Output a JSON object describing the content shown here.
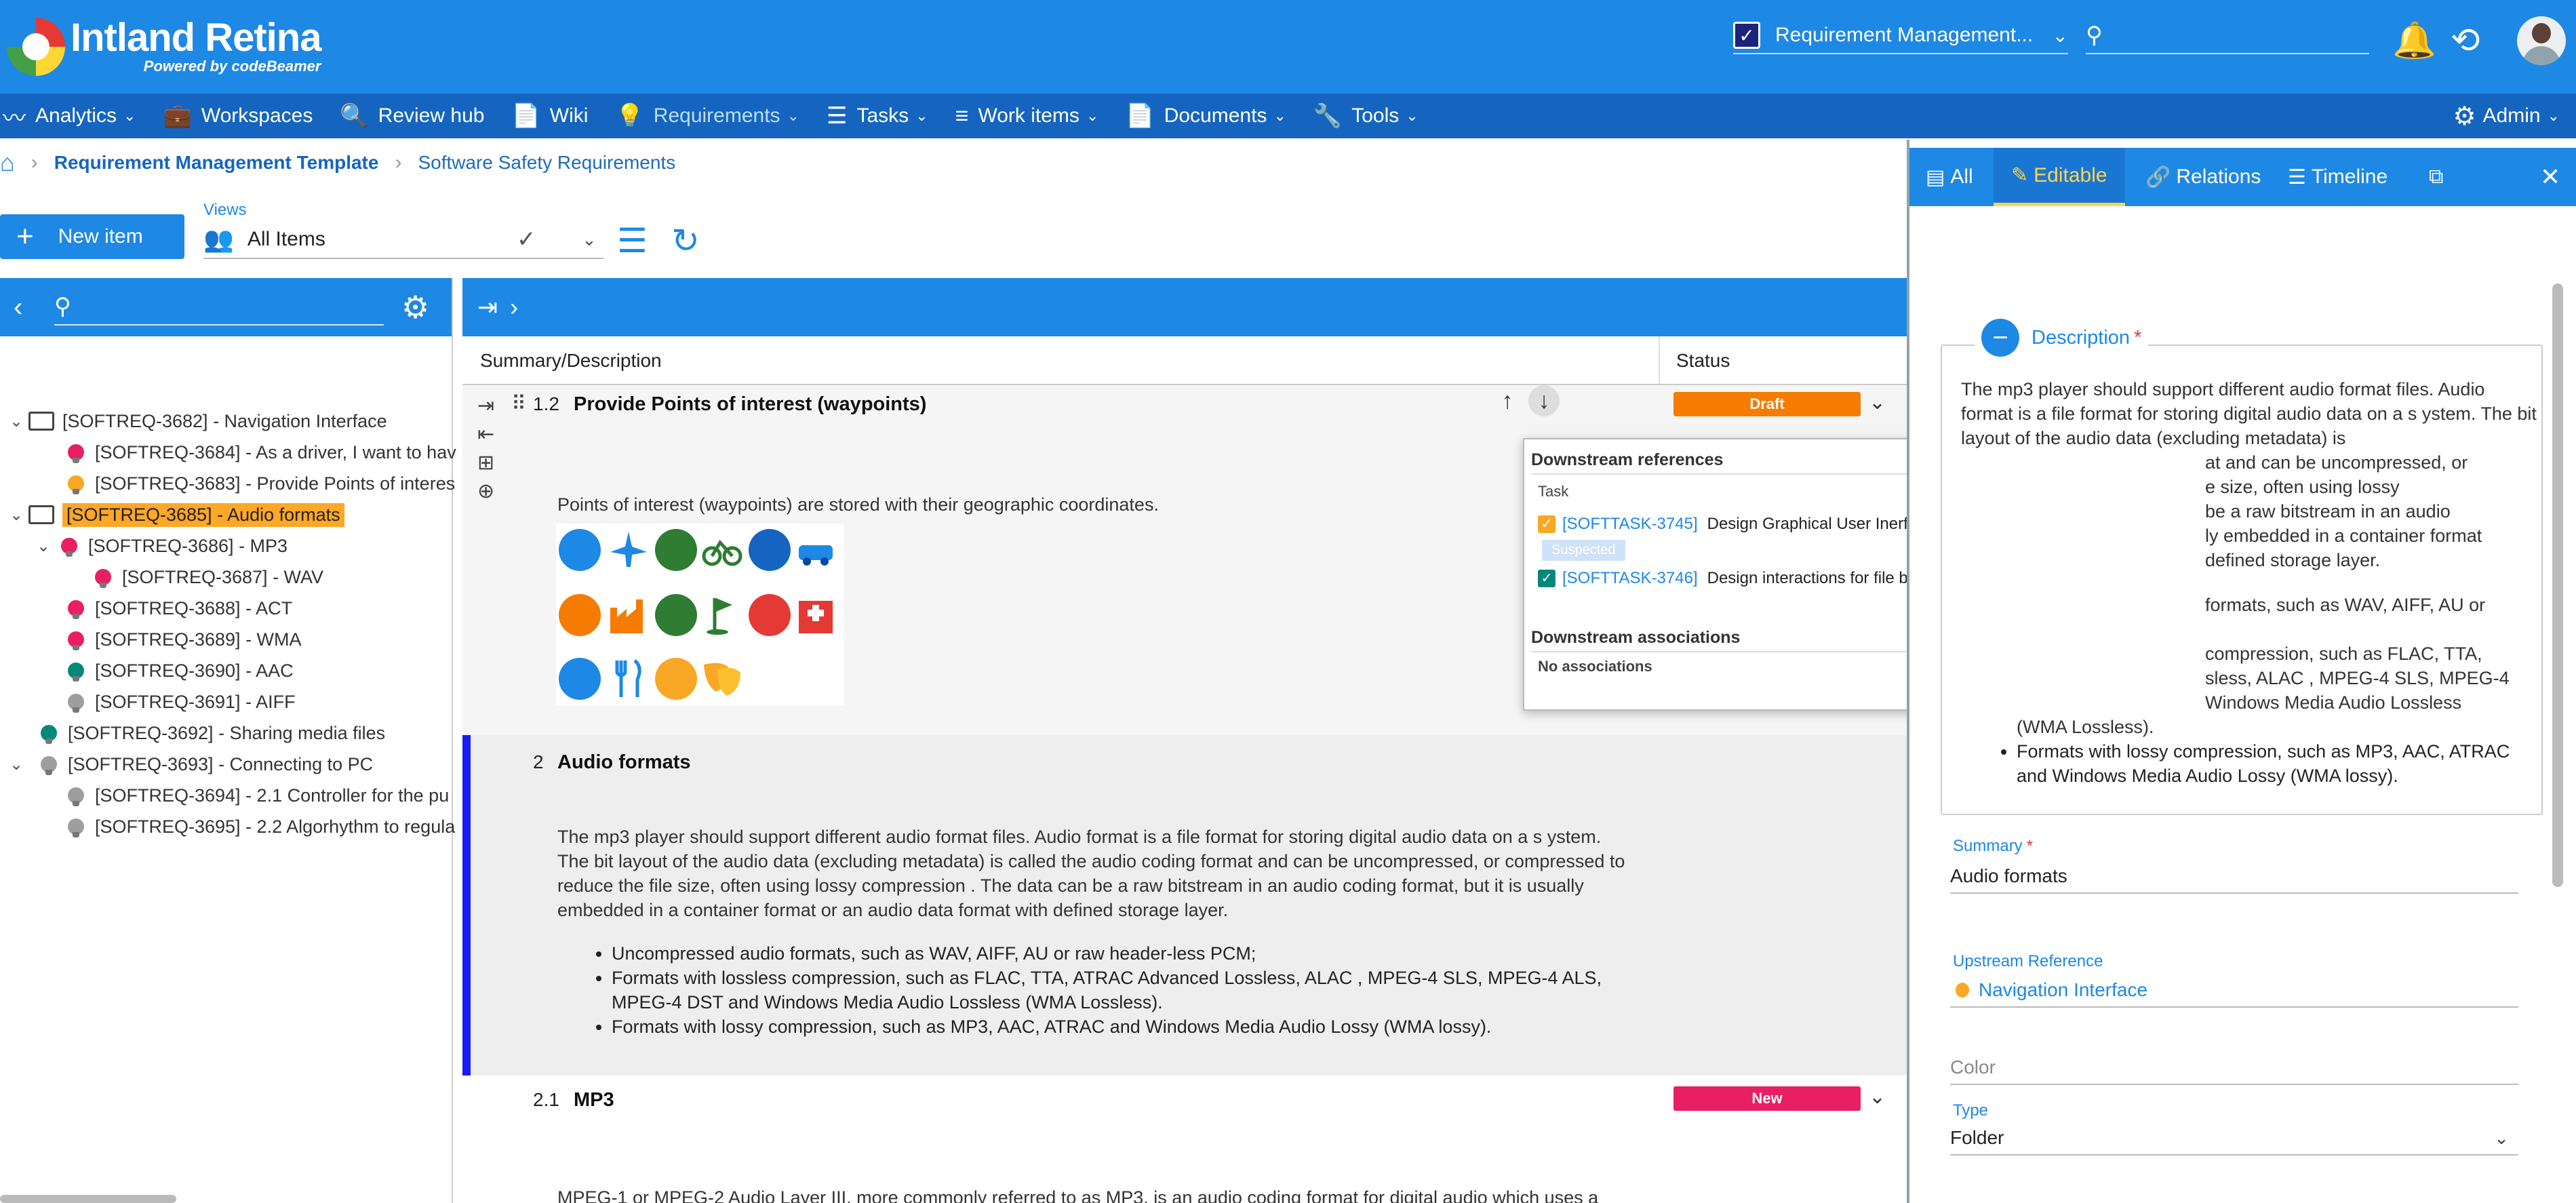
{
  "app": {
    "logo_title": "Intland Retina",
    "logo_sub": "Powered by codeBeamer",
    "project_select": "Requirement Management...",
    "search_placeholder": ""
  },
  "nav": {
    "items": [
      {
        "label": "Analytics",
        "icon": "chart-line-icon"
      },
      {
        "label": "Workspaces",
        "icon": "briefcase-icon"
      },
      {
        "label": "Review hub",
        "icon": "review-icon"
      },
      {
        "label": "Wiki",
        "icon": "document-icon"
      },
      {
        "label": "Requirements",
        "icon": "bulb-icon"
      },
      {
        "label": "Tasks",
        "icon": "tasks-icon"
      },
      {
        "label": "Work items",
        "icon": "list-icon"
      },
      {
        "label": "Documents",
        "icon": "document-icon"
      },
      {
        "label": "Tools",
        "icon": "wrench-icon"
      }
    ],
    "admin": "Admin"
  },
  "breadcrumb": {
    "project": "Requirement Management Template",
    "current": "Software Safety Requirements"
  },
  "toolbar": {
    "new_item": "New item",
    "views_label": "Views",
    "views_value": "All Items"
  },
  "tree": {
    "items": [
      {
        "label": "[SOFTREQ-3682] - Navigation Interface",
        "type": "folder",
        "color": ""
      },
      {
        "label": "[SOFTREQ-3684] - As a driver, I want to hav",
        "type": "bulb",
        "color": "#e91e63"
      },
      {
        "label": "[SOFTREQ-3683] - Provide Points of interes",
        "type": "bulb",
        "color": "#f9a825"
      },
      {
        "label": "[SOFTREQ-3685] - Audio formats",
        "type": "folder",
        "color": ""
      },
      {
        "label": "[SOFTREQ-3686] - MP3",
        "type": "bulb",
        "color": "#e91e63"
      },
      {
        "label": "[SOFTREQ-3687] - WAV",
        "type": "bulb",
        "color": "#e91e63"
      },
      {
        "label": "[SOFTREQ-3688] - ACT",
        "type": "bulb",
        "color": "#e91e63"
      },
      {
        "label": "[SOFTREQ-3689] - WMA",
        "type": "bulb",
        "color": "#e91e63"
      },
      {
        "label": "[SOFTREQ-3690] - AAC",
        "type": "bulb",
        "color": "#00897b"
      },
      {
        "label": "[SOFTREQ-3691] - AIFF",
        "type": "bulb",
        "color": "#9e9e9e"
      },
      {
        "label": "[SOFTREQ-3692] - Sharing media files",
        "type": "bulb",
        "color": "#00897b"
      },
      {
        "label": "[SOFTREQ-3693] - Connecting to PC",
        "type": "bulb",
        "color": "#9e9e9e"
      },
      {
        "label": "[SOFTREQ-3694] - 2.1 Controller for the pu",
        "type": "bulb",
        "color": "#9e9e9e"
      },
      {
        "label": "[SOFTREQ-3695] - 2.2 Algorhythm to regula",
        "type": "bulb",
        "color": "#9e9e9e"
      }
    ]
  },
  "table": {
    "col_summary": "Summary/Description",
    "col_status": "Status",
    "rows": [
      {
        "num": "1.2",
        "title": "Provide Points of interest (waypoints)",
        "text": "Points of interest (waypoints) are stored with their geographic coordinates.",
        "status": "Draft",
        "status_color": "#f57c00"
      },
      {
        "num": "2",
        "title": "Audio formats",
        "text": "The mp3 player should support different audio format files. Audio format is a file format for storing digital audio data on a s ystem. The bit layout of the audio data (excluding metadata) is called the audio coding format and can be uncompressed, or compressed to reduce the file size, often using lossy compression . The data can be a raw bitstream in an audio coding format, but it is usually embedded in a container format or an audio data format with defined storage layer.",
        "bullets": [
          "Uncompressed audio formats, such as WAV, AIFF, AU or raw header-less PCM;",
          "Formats with lossless compression, such as FLAC, TTA, ATRAC Advanced Lossless, ALAC , MPEG-4 SLS, MPEG-4 ALS, MPEG-4 DST and Windows Media Audio Lossless (WMA Lossless).",
          "Formats with lossy compression, such as MP3, AAC, ATRAC and Windows Media Audio Lossy (WMA lossy)."
        ]
      },
      {
        "num": "2.1",
        "title": "MP3",
        "text": "MPEG-1 or MPEG-2 Audio Layer III, more commonly referred to as MP3, is an audio coding format for digital audio which uses a",
        "status": "New",
        "status_color": "#e91e63"
      }
    ]
  },
  "popup": {
    "downstream_refs": "Downstream references",
    "task_label": "Task",
    "refs": [
      {
        "id": "[SOFTTASK-3745]",
        "title": "Design Graphical User Inerface of player",
        "cb_color": "#f9a825"
      },
      {
        "id": "[SOFTTASK-3746]",
        "title": "Design interactions for file browsing and previewing",
        "cb_color": "#00897b"
      }
    ],
    "suspected": "Suspected",
    "downstream_assoc": "Downstream associations",
    "no_assoc": "No associations"
  },
  "right_panel": {
    "tabs": [
      "All",
      "Editable",
      "Relations",
      "Timeline"
    ],
    "description_label": "Description",
    "description_text": "The mp3 player should support different audio format files. Audio format is a file format for storing digital audio data on a s ystem. The bit layout of the audio data (excluding metadata) is",
    "desc_fragments": [
      "at and can be uncompressed, or",
      "e size, often using lossy",
      "be a raw bitstream in an audio",
      "ly embedded in a container format",
      "defined storage layer."
    ],
    "desc_bullet_fragments": [
      "formats, such as WAV, AIFF, AU or",
      "compression, such as FLAC, TTA,",
      "sless, ALAC , MPEG-4 SLS, MPEG-4",
      "Windows Media Audio Lossless",
      "(WMA Lossless).",
      "Formats with lossy compression, such as MP3, AAC, ATRAC and Windows Media Audio Lossy (WMA lossy)."
    ],
    "summary_label": "Summary",
    "summary_value": "Audio formats",
    "upstream_label": "Upstream Reference",
    "upstream_value": "Navigation Interface",
    "color_label": "Color",
    "type_label": "Type",
    "type_value": "Folder"
  }
}
